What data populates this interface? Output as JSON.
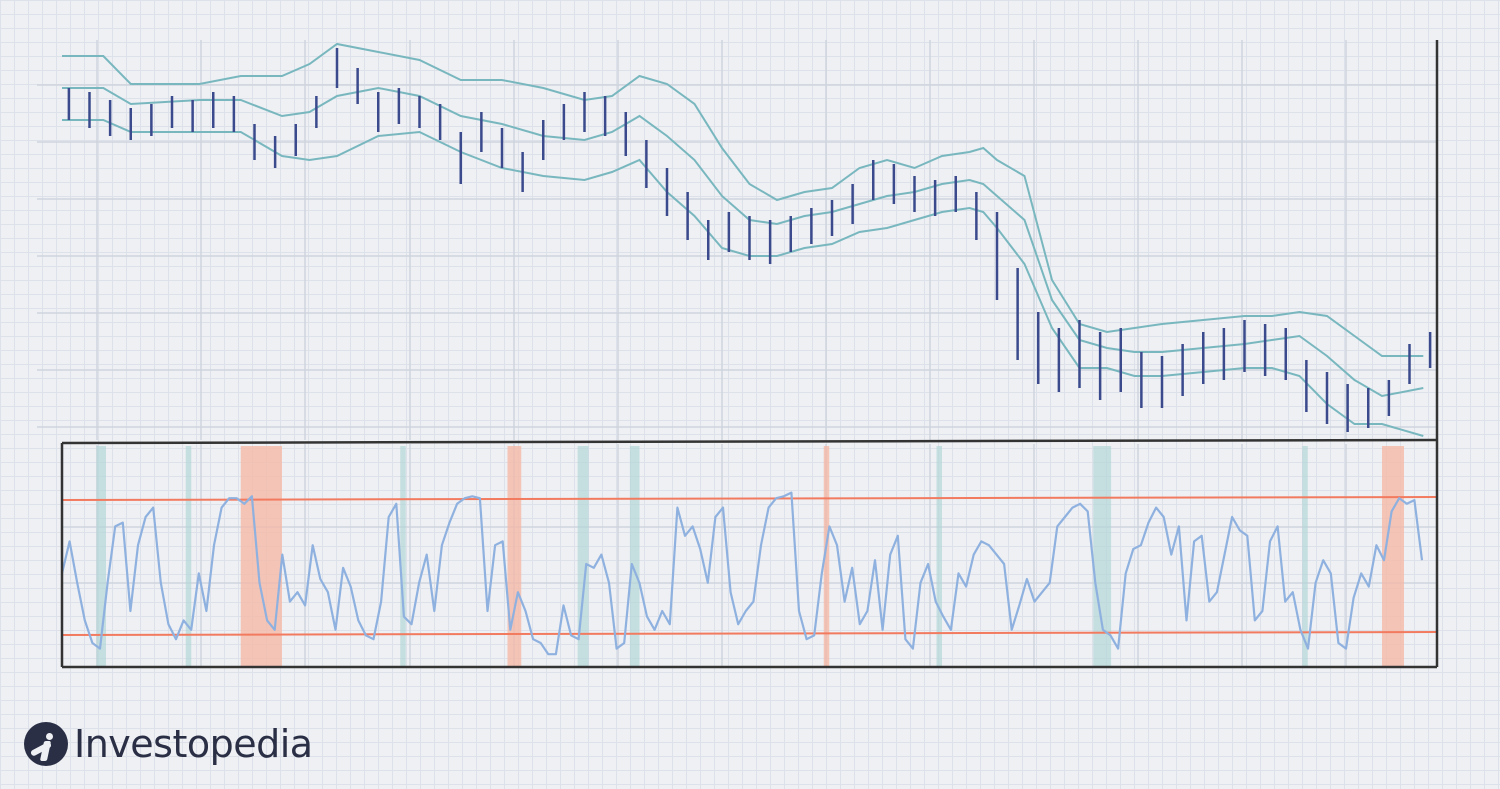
{
  "brand": {
    "name": "Investopedia"
  },
  "colors": {
    "bar": "#3a4a8c",
    "band": "#79b7bf",
    "oscillator": "#8fb1df",
    "threshold": "#f27a5f",
    "overbought_zone": "#f6b5a3",
    "oversold_zone": "#b3d6d6",
    "axis": "#333333"
  },
  "chart_data": [
    {
      "type": "ohlc",
      "panel": "price",
      "title": "",
      "xlabel": "",
      "ylabel": "",
      "overlay": "bollinger_bands",
      "x_range": [
        0,
        100
      ],
      "ylim": [
        0,
        100
      ],
      "grid": true,
      "bars_approx": [
        {
          "x": 0.5,
          "high": 88,
          "low": 80
        },
        {
          "x": 2,
          "high": 87,
          "low": 78
        },
        {
          "x": 3.5,
          "high": 85,
          "low": 76
        },
        {
          "x": 5,
          "high": 83,
          "low": 75
        },
        {
          "x": 6.5,
          "high": 84,
          "low": 76
        },
        {
          "x": 8,
          "high": 86,
          "low": 78
        },
        {
          "x": 9.5,
          "high": 85,
          "low": 77
        },
        {
          "x": 11,
          "high": 87,
          "low": 78
        },
        {
          "x": 12.5,
          "high": 86,
          "low": 77
        },
        {
          "x": 14,
          "high": 79,
          "low": 70
        },
        {
          "x": 15.5,
          "high": 76,
          "low": 68
        },
        {
          "x": 17,
          "high": 79,
          "low": 71
        },
        {
          "x": 18.5,
          "high": 86,
          "low": 78
        },
        {
          "x": 20,
          "high": 98,
          "low": 88
        },
        {
          "x": 21.5,
          "high": 93,
          "low": 84
        },
        {
          "x": 23,
          "high": 87,
          "low": 77
        },
        {
          "x": 24.5,
          "high": 88,
          "low": 79
        },
        {
          "x": 26,
          "high": 86,
          "low": 78
        },
        {
          "x": 27.5,
          "high": 84,
          "low": 75
        },
        {
          "x": 29,
          "high": 77,
          "low": 64
        },
        {
          "x": 30.5,
          "high": 82,
          "low": 72
        },
        {
          "x": 32,
          "high": 78,
          "low": 68
        },
        {
          "x": 33.5,
          "high": 72,
          "low": 62
        },
        {
          "x": 35,
          "high": 80,
          "low": 70
        },
        {
          "x": 36.5,
          "high": 84,
          "low": 75
        },
        {
          "x": 38,
          "high": 87,
          "low": 77
        },
        {
          "x": 39.5,
          "high": 86,
          "low": 76
        },
        {
          "x": 41,
          "high": 82,
          "low": 71
        },
        {
          "x": 42.5,
          "high": 75,
          "low": 63
        },
        {
          "x": 44,
          "high": 68,
          "low": 56
        },
        {
          "x": 45.5,
          "high": 62,
          "low": 50
        },
        {
          "x": 47,
          "high": 55,
          "low": 45
        },
        {
          "x": 48.5,
          "high": 57,
          "low": 47
        },
        {
          "x": 50,
          "high": 56,
          "low": 45
        },
        {
          "x": 51.5,
          "high": 55,
          "low": 44
        },
        {
          "x": 53,
          "high": 56,
          "low": 47
        },
        {
          "x": 54.5,
          "high": 58,
          "low": 49
        },
        {
          "x": 56,
          "high": 60,
          "low": 51
        },
        {
          "x": 57.5,
          "high": 64,
          "low": 54
        },
        {
          "x": 59,
          "high": 70,
          "low": 60
        },
        {
          "x": 60.5,
          "high": 69,
          "low": 59
        },
        {
          "x": 62,
          "high": 66,
          "low": 57
        },
        {
          "x": 63.5,
          "high": 65,
          "low": 56
        },
        {
          "x": 65,
          "high": 66,
          "low": 57
        },
        {
          "x": 66.5,
          "high": 62,
          "low": 50
        },
        {
          "x": 68,
          "high": 57,
          "low": 35
        },
        {
          "x": 69.5,
          "high": 43,
          "low": 20
        },
        {
          "x": 71,
          "high": 32,
          "low": 14
        },
        {
          "x": 72.5,
          "high": 28,
          "low": 12
        },
        {
          "x": 74,
          "high": 30,
          "low": 13
        },
        {
          "x": 75.5,
          "high": 27,
          "low": 10
        },
        {
          "x": 77,
          "high": 28,
          "low": 12
        },
        {
          "x": 78.5,
          "high": 22,
          "low": 8
        },
        {
          "x": 80,
          "high": 21,
          "low": 8
        },
        {
          "x": 81.5,
          "high": 24,
          "low": 11
        },
        {
          "x": 83,
          "high": 27,
          "low": 14
        },
        {
          "x": 84.5,
          "high": 28,
          "low": 15
        },
        {
          "x": 86,
          "high": 30,
          "low": 17
        },
        {
          "x": 87.5,
          "high": 29,
          "low": 16
        },
        {
          "x": 89,
          "high": 28,
          "low": 15
        },
        {
          "x": 90.5,
          "high": 20,
          "low": 7
        },
        {
          "x": 92,
          "high": 17,
          "low": 4
        },
        {
          "x": 93.5,
          "high": 14,
          "low": 2
        },
        {
          "x": 95,
          "high": 13,
          "low": 3
        },
        {
          "x": 96.5,
          "high": 15,
          "low": 6
        },
        {
          "x": 98,
          "high": 24,
          "low": 14
        },
        {
          "x": 99.5,
          "high": 27,
          "low": 18
        }
      ],
      "upper_band_approx": [
        [
          0,
          96
        ],
        [
          3,
          96
        ],
        [
          5,
          89
        ],
        [
          10,
          89
        ],
        [
          13,
          91
        ],
        [
          16,
          91
        ],
        [
          18,
          94
        ],
        [
          20,
          99
        ],
        [
          23,
          97
        ],
        [
          26,
          95
        ],
        [
          29,
          90
        ],
        [
          32,
          90
        ],
        [
          35,
          88
        ],
        [
          38,
          85
        ],
        [
          40,
          86
        ],
        [
          42,
          91
        ],
        [
          44,
          89
        ],
        [
          46,
          84
        ],
        [
          48,
          73
        ],
        [
          50,
          64
        ],
        [
          52,
          60
        ],
        [
          54,
          62
        ],
        [
          56,
          63
        ],
        [
          58,
          68
        ],
        [
          60,
          70
        ],
        [
          62,
          68
        ],
        [
          64,
          71
        ],
        [
          66,
          72
        ],
        [
          67,
          73
        ],
        [
          68,
          70
        ],
        [
          70,
          66
        ],
        [
          72,
          40
        ],
        [
          74,
          29
        ],
        [
          76,
          27
        ],
        [
          78,
          28
        ],
        [
          80,
          29
        ],
        [
          83,
          30
        ],
        [
          86,
          31
        ],
        [
          88,
          31
        ],
        [
          90,
          32
        ],
        [
          92,
          31
        ],
        [
          94,
          26
        ],
        [
          96,
          21
        ],
        [
          99,
          21
        ]
      ],
      "middle_band_approx": [
        [
          0,
          88
        ],
        [
          3,
          88
        ],
        [
          5,
          84
        ],
        [
          10,
          85
        ],
        [
          13,
          85
        ],
        [
          16,
          81
        ],
        [
          18,
          82
        ],
        [
          20,
          86
        ],
        [
          23,
          88
        ],
        [
          26,
          86
        ],
        [
          29,
          81
        ],
        [
          32,
          79
        ],
        [
          35,
          76
        ],
        [
          38,
          75
        ],
        [
          40,
          77
        ],
        [
          42,
          81
        ],
        [
          44,
          76
        ],
        [
          46,
          70
        ],
        [
          48,
          61
        ],
        [
          50,
          55
        ],
        [
          52,
          54
        ],
        [
          54,
          56
        ],
        [
          56,
          57
        ],
        [
          58,
          59
        ],
        [
          60,
          61
        ],
        [
          62,
          62
        ],
        [
          64,
          64
        ],
        [
          66,
          65
        ],
        [
          67,
          64
        ],
        [
          68,
          61
        ],
        [
          70,
          55
        ],
        [
          72,
          35
        ],
        [
          74,
          25
        ],
        [
          76,
          23
        ],
        [
          78,
          22
        ],
        [
          80,
          22
        ],
        [
          83,
          23
        ],
        [
          86,
          24
        ],
        [
          88,
          25
        ],
        [
          90,
          26
        ],
        [
          92,
          21
        ],
        [
          94,
          15
        ],
        [
          96,
          11
        ],
        [
          99,
          13
        ]
      ],
      "lower_band_approx": [
        [
          0,
          80
        ],
        [
          3,
          80
        ],
        [
          5,
          77
        ],
        [
          10,
          77
        ],
        [
          13,
          77
        ],
        [
          16,
          71
        ],
        [
          18,
          70
        ],
        [
          20,
          71
        ],
        [
          23,
          76
        ],
        [
          26,
          77
        ],
        [
          29,
          72
        ],
        [
          32,
          68
        ],
        [
          35,
          66
        ],
        [
          38,
          65
        ],
        [
          40,
          67
        ],
        [
          42,
          70
        ],
        [
          44,
          62
        ],
        [
          46,
          56
        ],
        [
          48,
          48
        ],
        [
          50,
          46
        ],
        [
          52,
          46
        ],
        [
          54,
          48
        ],
        [
          56,
          49
        ],
        [
          58,
          52
        ],
        [
          60,
          53
        ],
        [
          62,
          55
        ],
        [
          64,
          57
        ],
        [
          66,
          58
        ],
        [
          67,
          57
        ],
        [
          68,
          53
        ],
        [
          70,
          44
        ],
        [
          72,
          28
        ],
        [
          74,
          18
        ],
        [
          76,
          18
        ],
        [
          78,
          16
        ],
        [
          80,
          16
        ],
        [
          83,
          17
        ],
        [
          86,
          18
        ],
        [
          88,
          18
        ],
        [
          90,
          16
        ],
        [
          92,
          9
        ],
        [
          94,
          4
        ],
        [
          96,
          4
        ],
        [
          99,
          1
        ]
      ]
    },
    {
      "type": "line",
      "panel": "oscillator",
      "title": "",
      "xlabel": "",
      "ylabel": "",
      "x_range": [
        0,
        100
      ],
      "ylim": [
        0,
        100
      ],
      "upper_threshold": 80,
      "lower_threshold": 20,
      "values_approx": [
        45,
        62,
        40,
        20,
        8,
        5,
        40,
        70,
        72,
        25,
        60,
        75,
        80,
        40,
        18,
        10,
        20,
        15,
        45,
        25,
        60,
        80,
        85,
        85,
        82,
        86,
        40,
        20,
        15,
        55,
        30,
        35,
        28,
        60,
        42,
        35,
        15,
        48,
        38,
        20,
        12,
        10,
        30,
        75,
        82,
        22,
        18,
        40,
        55,
        25,
        60,
        72,
        82,
        85,
        86,
        85,
        25,
        60,
        62,
        15,
        35,
        25,
        10,
        8,
        2,
        2,
        28,
        12,
        10,
        50,
        48,
        55,
        40,
        5,
        8,
        50,
        40,
        22,
        15,
        25,
        18,
        80,
        65,
        70,
        58,
        40,
        75,
        80,
        35,
        18,
        25,
        30,
        60,
        80,
        85,
        86,
        88,
        25,
        10,
        12,
        45,
        70,
        60,
        30,
        48,
        18,
        25,
        52,
        15,
        55,
        65,
        10,
        5,
        40,
        50,
        30,
        22,
        15,
        45,
        38,
        55,
        62,
        60,
        55,
        50,
        15,
        28,
        42,
        30,
        35,
        40,
        70,
        75,
        80,
        82,
        78,
        40,
        15,
        12,
        5,
        45,
        58,
        60,
        72,
        80,
        75,
        55,
        70,
        20,
        62,
        65,
        30,
        35,
        55,
        75,
        68,
        65,
        20,
        25,
        62,
        70,
        30,
        35,
        15,
        5,
        40,
        52,
        45,
        8,
        5,
        32,
        45,
        38,
        60,
        52,
        78,
        85,
        82,
        84,
        52
      ],
      "shaded_regions": [
        {
          "kind": "oversold",
          "x": [
            2.5,
            3.2
          ]
        },
        {
          "kind": "oversold",
          "x": [
            9.0,
            9.4
          ]
        },
        {
          "kind": "overbought",
          "x": [
            13.0,
            16.0
          ]
        },
        {
          "kind": "oversold",
          "x": [
            24.6,
            25.0
          ]
        },
        {
          "kind": "overbought",
          "x": [
            32.4,
            33.4
          ]
        },
        {
          "kind": "oversold",
          "x": [
            37.5,
            38.3
          ]
        },
        {
          "kind": "oversold",
          "x": [
            41.3,
            42.0
          ]
        },
        {
          "kind": "overbought",
          "x": [
            55.4,
            55.8
          ]
        },
        {
          "kind": "oversold",
          "x": [
            63.6,
            64.0
          ]
        },
        {
          "kind": "oversold",
          "x": [
            75.0,
            76.3
          ]
        },
        {
          "kind": "oversold",
          "x": [
            90.2,
            90.6
          ]
        },
        {
          "kind": "overbought",
          "x": [
            96.0,
            97.6
          ]
        }
      ]
    }
  ]
}
